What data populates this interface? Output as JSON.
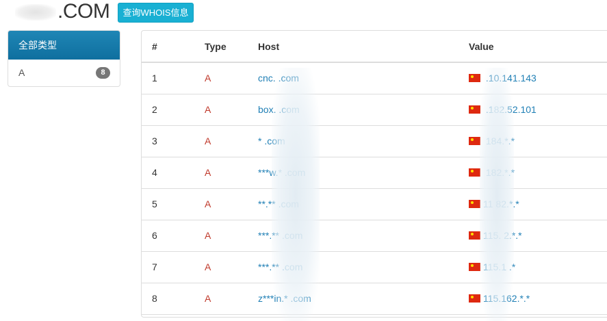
{
  "header": {
    "domain_suffix": ".COM",
    "whois_button_label": "查询WHOIS信息"
  },
  "sidebar": {
    "panel_title": "全部类型",
    "items": [
      {
        "label": "A",
        "count": "8"
      }
    ]
  },
  "table": {
    "columns": [
      "#",
      "Type",
      "Host",
      "Value"
    ],
    "rows": [
      {
        "num": "1",
        "type": "A",
        "host": "cnc.     .com",
        "value": "   .10.141.143"
      },
      {
        "num": "2",
        "type": "A",
        "host": "box.     .com",
        "value": "   .182.52.101"
      },
      {
        "num": "3",
        "type": "A",
        "host": "*   .com",
        "value": "   184.*.*"
      },
      {
        "num": "4",
        "type": "A",
        "host": "***w.*   .com",
        "value": "   182.*.*"
      },
      {
        "num": "5",
        "type": "A",
        "host": "**.**  .com",
        "value": "11  82.*.*"
      },
      {
        "num": "6",
        "type": "A",
        "host": "***.**   .com",
        "value": "115.  2.*.*"
      },
      {
        "num": "7",
        "type": "A",
        "host": "***.**   .com",
        "value": "115.1   .*"
      },
      {
        "num": "8",
        "type": "A",
        "host": "z***in.*   .com",
        "value": "115.162.*.*"
      }
    ]
  },
  "colors": {
    "accent_header": "#0f6f9f",
    "button": "#19b0d3",
    "type_red": "#c0392b",
    "link_blue": "#1f7fb5",
    "badge_gray": "#777777"
  },
  "icons": {
    "flag": "china-flag-icon"
  }
}
